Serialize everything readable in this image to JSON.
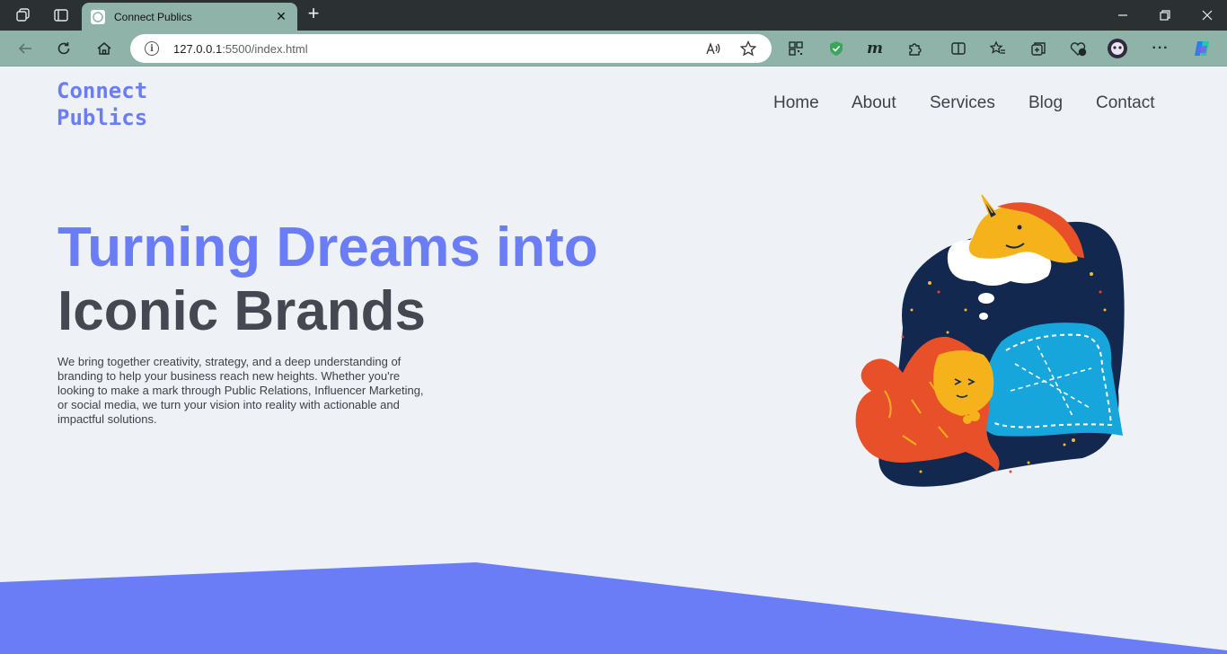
{
  "browser": {
    "tab_title": "Connect Publics",
    "address_host": "127.0.0.1",
    "address_path": ":5500/index.html"
  },
  "site": {
    "logo_line1": "Connect",
    "logo_line2": "Publics",
    "nav": [
      "Home",
      "About",
      "Services",
      "Blog",
      "Contact"
    ]
  },
  "hero": {
    "line1": "Turning Dreams into",
    "line2": "Iconic Brands",
    "description": "We bring together creativity, strategy, and a deep understanding of branding to help your business reach new heights. Whether you're looking to make a mark through Public Relations, Influencer Marketing, or social media, we turn your vision into reality with actionable and impactful solutions."
  },
  "colors": {
    "accent": "#6a7cf6",
    "heading_dark": "#464851",
    "page_bg": "#eef2f6",
    "chrome_tab": "#8fb3a9",
    "chrome_dark": "#2b3033"
  }
}
